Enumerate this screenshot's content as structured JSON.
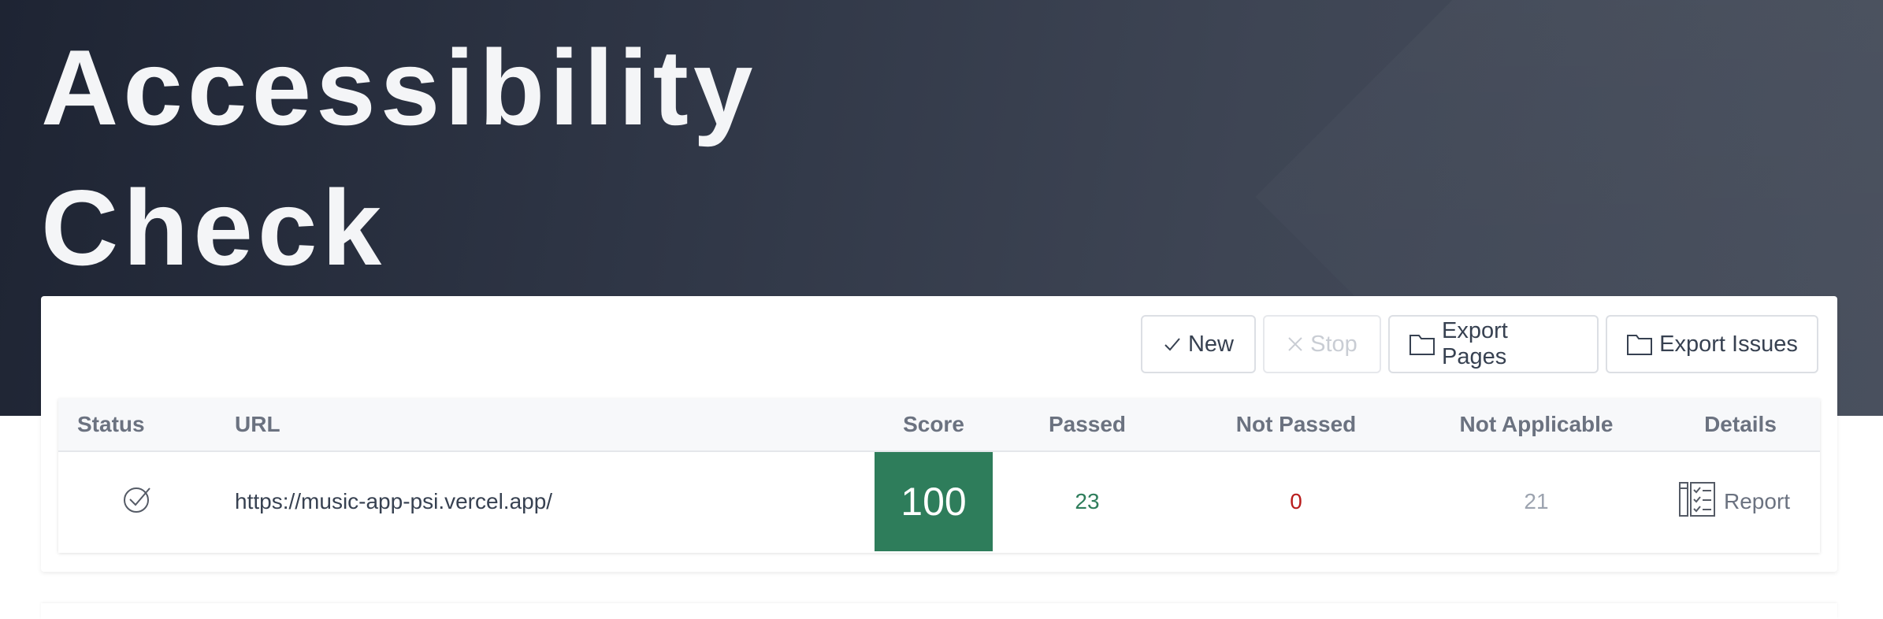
{
  "header": {
    "title": "Accessibility Check"
  },
  "toolbar": {
    "buttons": [
      {
        "label": "New",
        "icon": "check-icon",
        "enabled": true
      },
      {
        "label": "Stop",
        "icon": "close-icon",
        "enabled": false
      },
      {
        "label": "Export Pages",
        "icon": "folder-icon",
        "enabled": true
      },
      {
        "label": "Export Issues",
        "icon": "folder-icon",
        "enabled": true
      }
    ]
  },
  "table": {
    "columns": [
      "Status",
      "URL",
      "Score",
      "Passed",
      "Not Passed",
      "Not Applicable",
      "Details"
    ],
    "rows": [
      {
        "status_icon": "check-circle-icon",
        "url": "https://music-app-psi.vercel.app/",
        "score": "100",
        "passed": "23",
        "not_passed": "0",
        "not_applicable": "21",
        "details_label": "Report",
        "details_icon": "checklist-report-icon"
      }
    ]
  },
  "colors": {
    "hero_dark": "#1e2433",
    "hero_light": "#474e5c",
    "score_bg": "#2e7d5b",
    "passed": "#2e7d5b",
    "not_passed": "#b91c1c",
    "not_applicable": "#9ca3af"
  }
}
